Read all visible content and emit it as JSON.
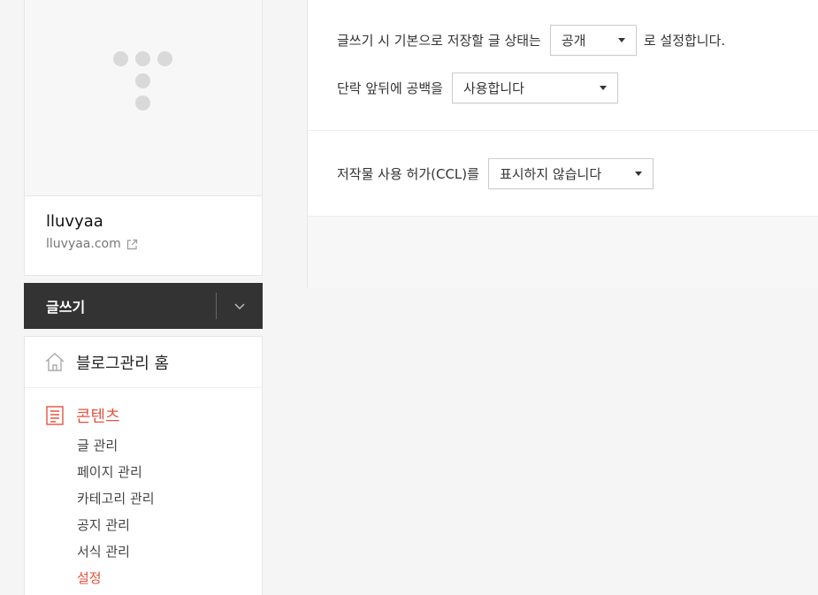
{
  "profile": {
    "blog_name": "lluvyaa",
    "blog_url": "lluvyaa.com"
  },
  "write": {
    "label": "글쓰기"
  },
  "menu": {
    "home_label": "블로그관리 홈",
    "content_section": {
      "title": "콘텐츠",
      "items": [
        {
          "label": "글 관리",
          "active": false
        },
        {
          "label": "페이지 관리",
          "active": false
        },
        {
          "label": "카테고리 관리",
          "active": false
        },
        {
          "label": "공지 관리",
          "active": false
        },
        {
          "label": "서식 관리",
          "active": false
        },
        {
          "label": "설정",
          "active": true
        }
      ]
    }
  },
  "settings": {
    "default_status": {
      "prefix": "글쓰기 시 기본으로 저장할 글 상태는",
      "value": "공개",
      "suffix": "로 설정합니다."
    },
    "paragraph_spacing": {
      "prefix": "단락 앞뒤에 공백을",
      "value": "사용합니다"
    },
    "ccl": {
      "prefix": "저작물 사용 허가(CCL)를",
      "value": "표시하지 않습니다"
    }
  },
  "colors": {
    "accent": "#e5533d",
    "dark_bar": "#333333"
  },
  "icons": {
    "profile_placeholder": "t-logo-dots-icon",
    "external_link": "external-link-icon",
    "write_toggle": "chevron-down-icon",
    "home": "house-icon",
    "content": "document-icon",
    "select_caret": "caret-down-icon"
  }
}
